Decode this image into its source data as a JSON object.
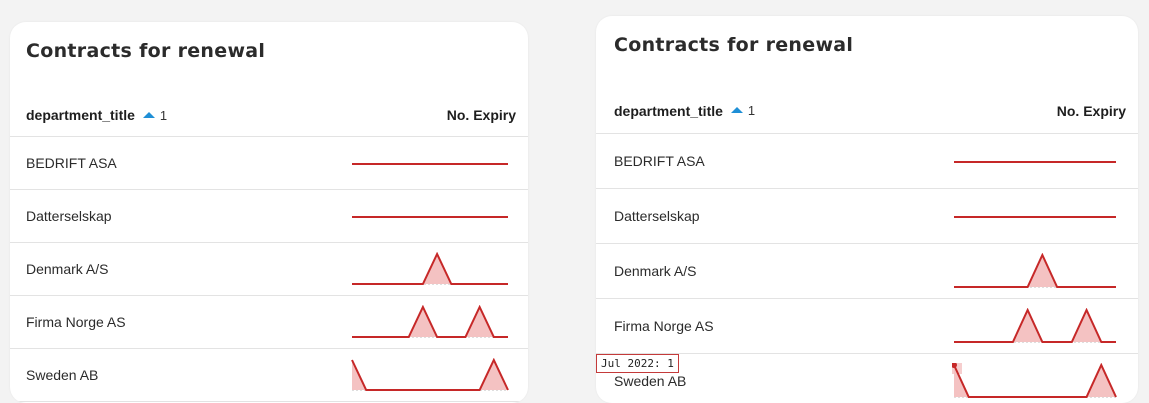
{
  "panels": [
    {
      "title": "Contracts for renewal",
      "columns": {
        "department": "department_title",
        "sort_rank": "1",
        "expiry": "No. Expiry"
      },
      "rows": [
        {
          "label": "BEDRIFT ASA",
          "spark": [
            1,
            1,
            1,
            1,
            1,
            1,
            1,
            1,
            1,
            1,
            1,
            1
          ]
        },
        {
          "label": "Datterselskap",
          "spark": [
            1,
            1,
            1,
            1,
            1,
            1,
            1,
            1,
            1,
            1,
            1,
            1
          ]
        },
        {
          "label": "Denmark A/S",
          "spark": [
            0,
            0,
            0,
            0,
            0,
            0,
            1,
            0,
            0,
            0,
            0,
            0
          ]
        },
        {
          "label": "Firma Norge AS",
          "spark": [
            0,
            0,
            0,
            0,
            0,
            1,
            0,
            0,
            0,
            1,
            0,
            0
          ]
        },
        {
          "label": "Sweden AB",
          "spark": [
            1,
            0,
            0,
            0,
            0,
            0,
            0,
            0,
            0,
            0,
            1,
            0
          ]
        }
      ]
    },
    {
      "title": "Contracts for renewal",
      "columns": {
        "department": "department_title",
        "sort_rank": "1",
        "expiry": "No. Expiry"
      },
      "rows": [
        {
          "label": "BEDRIFT ASA",
          "spark": [
            1,
            1,
            1,
            1,
            1,
            1,
            1,
            1,
            1,
            1,
            1,
            1
          ]
        },
        {
          "label": "Datterselskap",
          "spark": [
            1,
            1,
            1,
            1,
            1,
            1,
            1,
            1,
            1,
            1,
            1,
            1
          ]
        },
        {
          "label": "Denmark A/S",
          "spark": [
            0,
            0,
            0,
            0,
            0,
            0,
            1,
            0,
            0,
            0,
            0,
            0
          ]
        },
        {
          "label": "Firma Norge AS",
          "spark": [
            0,
            0,
            0,
            0,
            0,
            1,
            0,
            0,
            0,
            1,
            0,
            0
          ]
        },
        {
          "label": "Sweden AB",
          "spark": [
            1,
            0,
            0,
            0,
            0,
            0,
            0,
            0,
            0,
            0,
            1,
            0
          ]
        }
      ],
      "tooltip": {
        "text": "Jul 2022: 1",
        "row": 4,
        "point": 0
      }
    }
  ],
  "colors": {
    "line": "#c62828",
    "fill": "#f4c2c2",
    "baseline": "#bdbdbd",
    "sort": "#1f8fd6"
  }
}
